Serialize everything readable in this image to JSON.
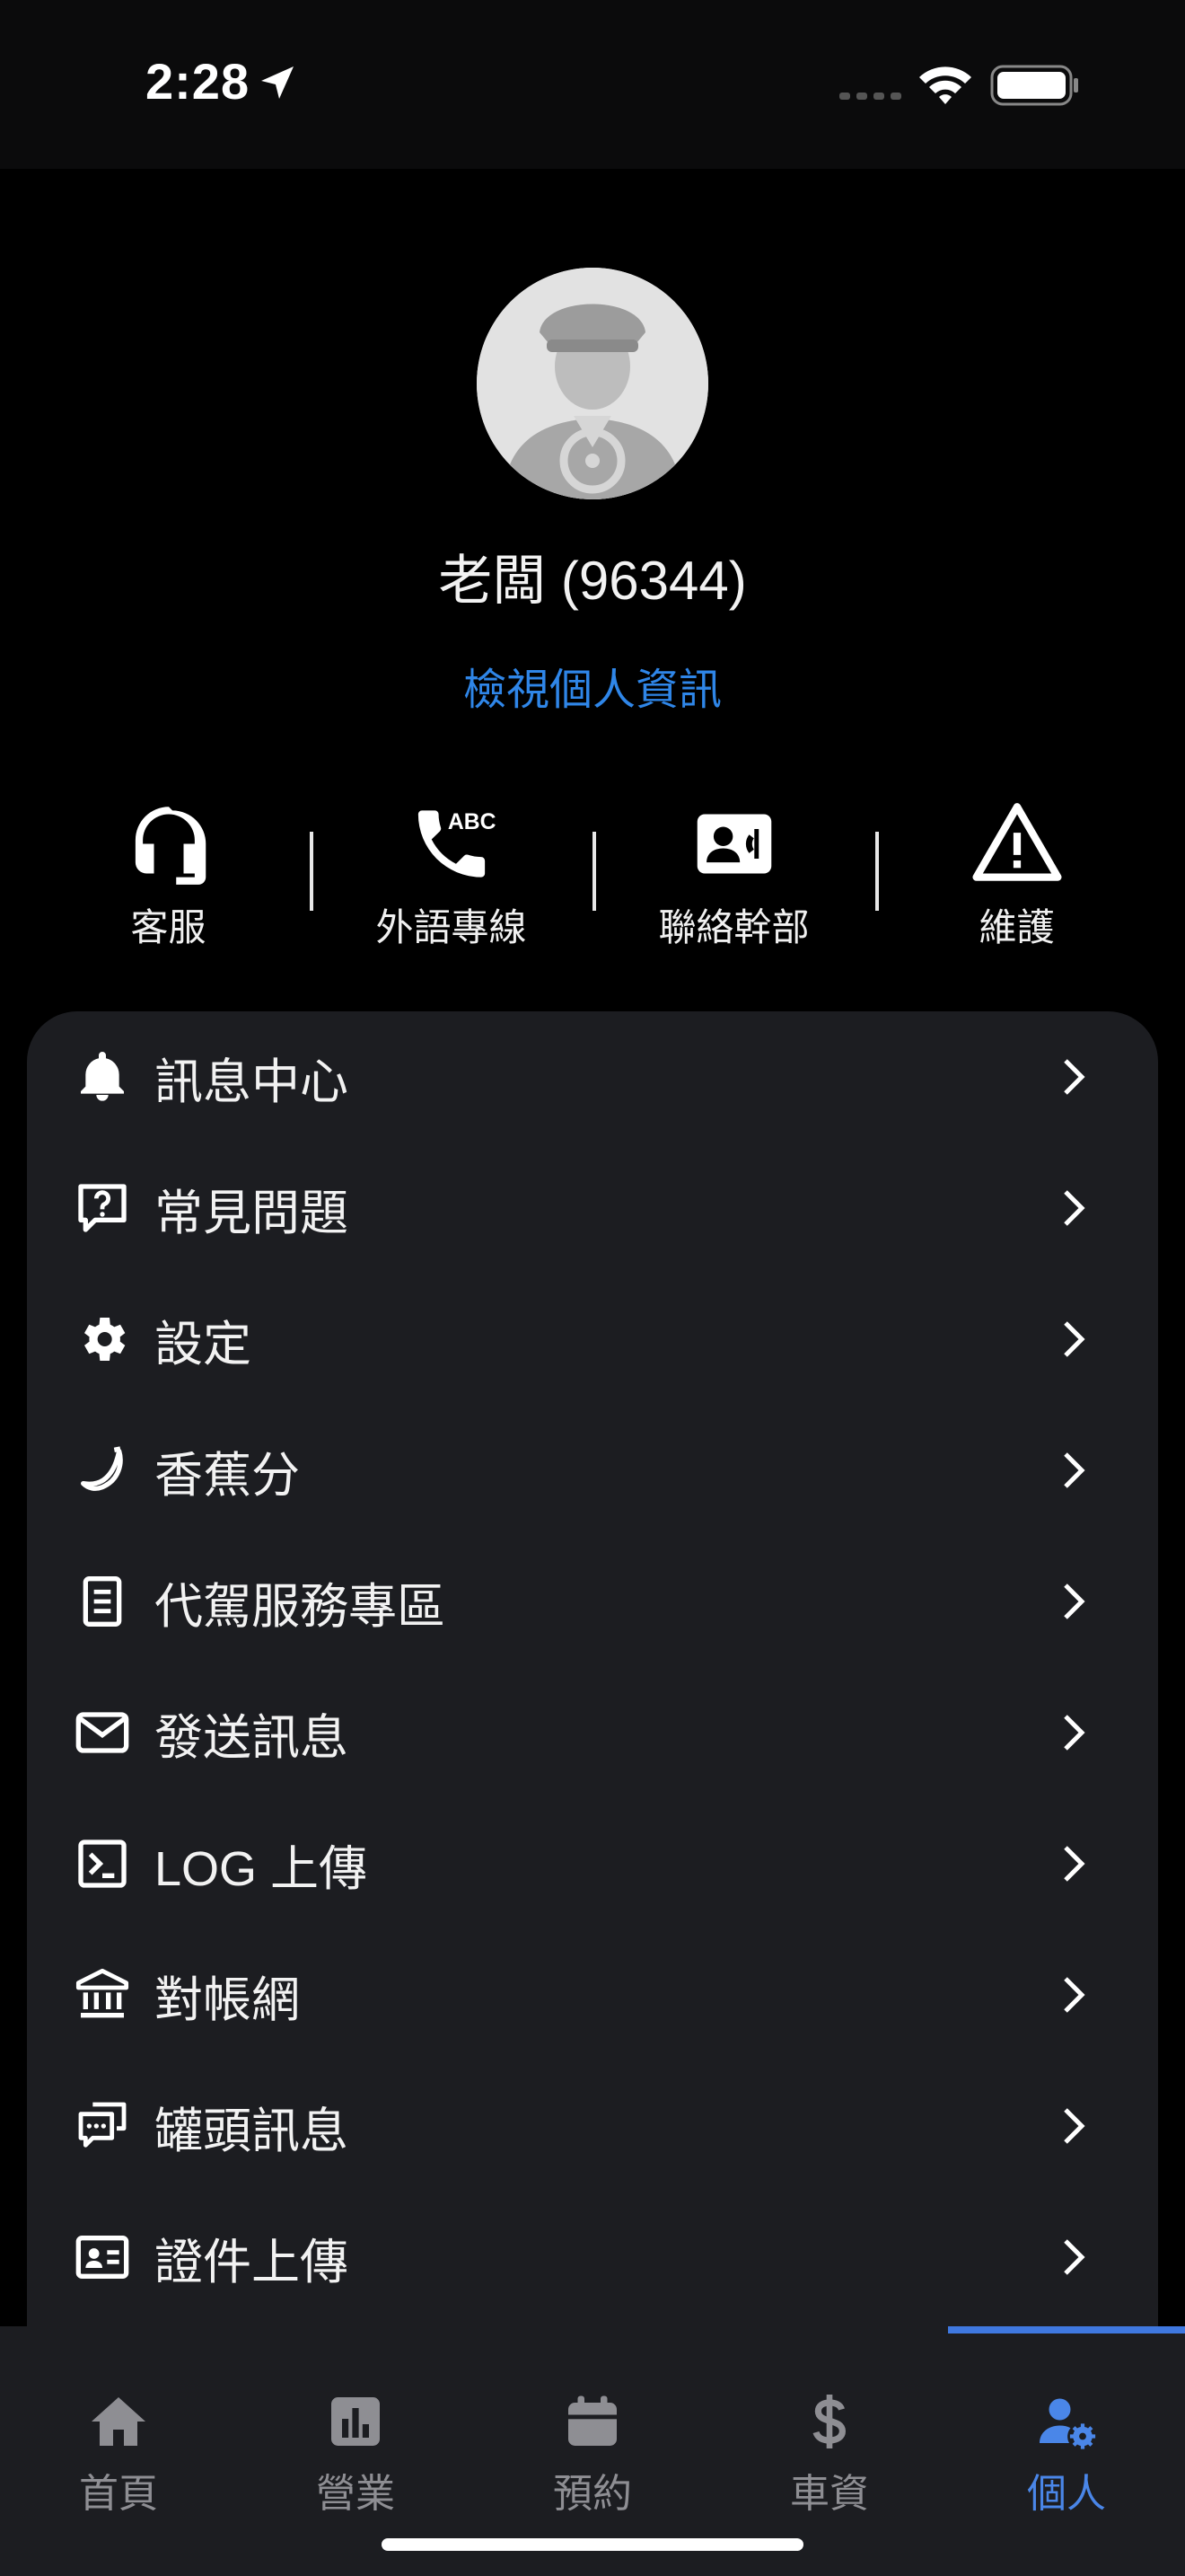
{
  "status_bar": {
    "time": "2:28"
  },
  "profile": {
    "name": "老闆 (96344)",
    "view_link": "檢視個人資訊"
  },
  "quick_actions": [
    {
      "label": "客服",
      "icon": "headset-icon"
    },
    {
      "label": "外語專線",
      "icon": "phone-abc-icon"
    },
    {
      "label": "聯絡幹部",
      "icon": "contact-card-icon"
    },
    {
      "label": "維護",
      "icon": "warning-icon"
    }
  ],
  "menu": [
    {
      "label": "訊息中心",
      "icon": "bell-icon"
    },
    {
      "label": "常見問題",
      "icon": "question-chat-icon"
    },
    {
      "label": "設定",
      "icon": "gear-icon"
    },
    {
      "label": "香蕉分",
      "icon": "banana-icon"
    },
    {
      "label": "代駕服務專區",
      "icon": "document-icon"
    },
    {
      "label": "發送訊息",
      "icon": "mail-icon"
    },
    {
      "label": "LOG 上傳",
      "icon": "terminal-icon"
    },
    {
      "label": "對帳網",
      "icon": "bank-icon"
    },
    {
      "label": "罐頭訊息",
      "icon": "chat-bubbles-icon"
    },
    {
      "label": "證件上傳",
      "icon": "id-card-icon"
    }
  ],
  "tabs": [
    {
      "label": "首頁",
      "icon": "home-icon",
      "active": false
    },
    {
      "label": "營業",
      "icon": "chart-icon",
      "active": false
    },
    {
      "label": "預約",
      "icon": "calendar-icon",
      "active": false
    },
    {
      "label": "車資",
      "icon": "dollar-icon",
      "active": false
    },
    {
      "label": "個人",
      "icon": "user-gear-icon",
      "active": true
    }
  ],
  "colors": {
    "accent": "#2f86e8",
    "tab_active": "#4a86e8",
    "card_bg": "#1c1d21"
  }
}
